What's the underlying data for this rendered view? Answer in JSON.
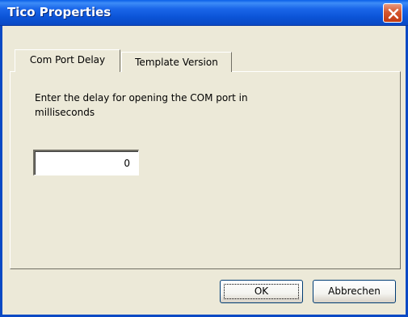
{
  "window": {
    "title": "Tico Properties"
  },
  "tabs": [
    {
      "label": "Com Port Delay",
      "active": true
    },
    {
      "label": "Template Version",
      "active": false
    }
  ],
  "com_port_delay": {
    "description": "Enter the delay for opening the COM port in milliseconds",
    "delay_value": "0"
  },
  "buttons": {
    "ok_label": "OK",
    "cancel_label": "Abbrechen"
  },
  "colors": {
    "titlebar": "#0A5FE8",
    "dialog_bg": "#ECE9D8",
    "close_button": "#D5572E"
  },
  "icons": {
    "close": "close-icon"
  }
}
